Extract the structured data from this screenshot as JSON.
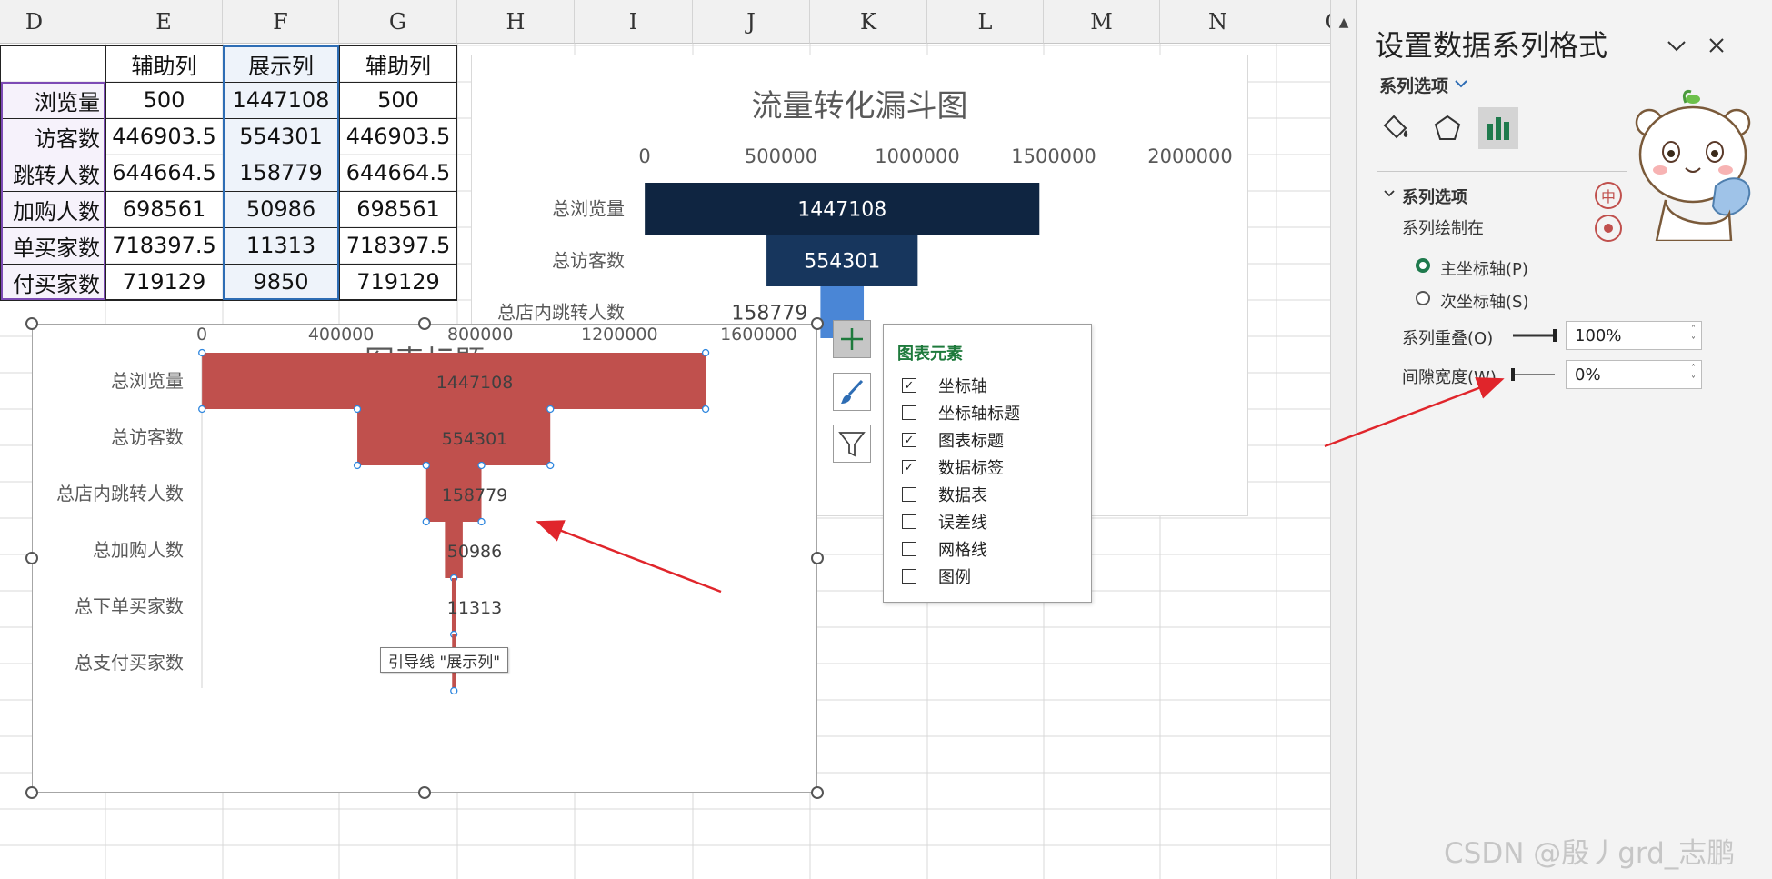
{
  "sheet": {
    "columns": [
      "D",
      "E",
      "F",
      "G",
      "H",
      "I",
      "J",
      "K",
      "L",
      "M",
      "N",
      "O"
    ],
    "table": {
      "headers": [
        "",
        "辅助列",
        "展示列",
        "辅助列"
      ],
      "rows": [
        {
          "label": "浏览量",
          "aux1": "500",
          "show": "1447108",
          "aux2": "500"
        },
        {
          "label": "访客数",
          "aux1": "446903.5",
          "show": "554301",
          "aux2": "446903.5"
        },
        {
          "label": "跳转人数",
          "aux1": "644664.5",
          "show": "158779",
          "aux2": "644664.5"
        },
        {
          "label": "加购人数",
          "aux1": "698561",
          "show": "50986",
          "aux2": "698561"
        },
        {
          "label": "单买家数",
          "aux1": "718397.5",
          "show": "11313",
          "aux2": "718397.5"
        },
        {
          "label": "付买家数",
          "aux1": "719129",
          "show": "9850",
          "aux2": "719129"
        }
      ]
    }
  },
  "chart_data": [
    {
      "type": "bar",
      "title": "流量转化漏斗图",
      "categories": [
        "总浏览量",
        "总访客数",
        "总店内跳转人数"
      ],
      "series": [
        {
          "values": [
            1447108,
            554301,
            158779
          ]
        }
      ],
      "offsets": [
        500,
        446903.5,
        644664.5
      ],
      "axis_ticks": [
        "0",
        "500000",
        "1000000",
        "1500000",
        "2000000"
      ],
      "xlim": [
        0,
        2000000
      ],
      "data_labels": [
        "1447108",
        "554301",
        "158779"
      ],
      "colors": [
        "#0f2541",
        "#17365d",
        "#4a86d6"
      ]
    },
    {
      "type": "bar",
      "title": "图表标题",
      "categories": [
        "总浏览量",
        "总访客数",
        "总店内跳转人数",
        "总加购人数",
        "总下单买家数",
        "总支付买家数"
      ],
      "series": [
        {
          "values": [
            1447108,
            554301,
            158779,
            50986,
            11313,
            9850
          ]
        }
      ],
      "offsets": [
        500,
        446903.5,
        644664.5,
        698561,
        718397.5,
        719129
      ],
      "axis_ticks": [
        "0",
        "400000",
        "800000",
        "1200000",
        "1600000"
      ],
      "xlim": [
        0,
        1450000
      ],
      "data_labels": [
        "1447108",
        "554301",
        "158779",
        "50986",
        "11313",
        "9850"
      ],
      "color": "#c0504d"
    }
  ],
  "tooltip": "引导线 \"展示列\"",
  "chart_elements": {
    "title": "图表元素",
    "items": [
      {
        "label": "坐标轴",
        "checked": true,
        "mark": "✓"
      },
      {
        "label": "坐标轴标题",
        "checked": false,
        "mark": ""
      },
      {
        "label": "图表标题",
        "checked": true,
        "mark": "✓"
      },
      {
        "label": "数据标签",
        "checked": true,
        "mark": "✓"
      },
      {
        "label": "数据表",
        "checked": false,
        "mark": ""
      },
      {
        "label": "误差线",
        "checked": false,
        "mark": ""
      },
      {
        "label": "网格线",
        "checked": false,
        "mark": ""
      },
      {
        "label": "图例",
        "checked": false,
        "mark": ""
      }
    ]
  },
  "pane": {
    "title": "设置数据系列格式",
    "subtitle": "系列选项",
    "section": "系列选项",
    "plot_on": "系列绘制在",
    "primary_axis": "主坐标轴(P)",
    "secondary_axis": "次坐标轴(S)",
    "overlap_label": "系列重叠(O)",
    "overlap_value": "100%",
    "overlap_fraction": 1.0,
    "gap_label": "间隙宽度(W)",
    "gap_value": "0%",
    "gap_fraction": 0.0,
    "badge": "中"
  },
  "watermark": "CSDN @殷丿grd_志鹏",
  "colors": {
    "accent_green": "#1f7a4d",
    "chart_red": "#c0504d",
    "chart_navy": "#0f2541",
    "arrow_red": "#e0252b"
  }
}
